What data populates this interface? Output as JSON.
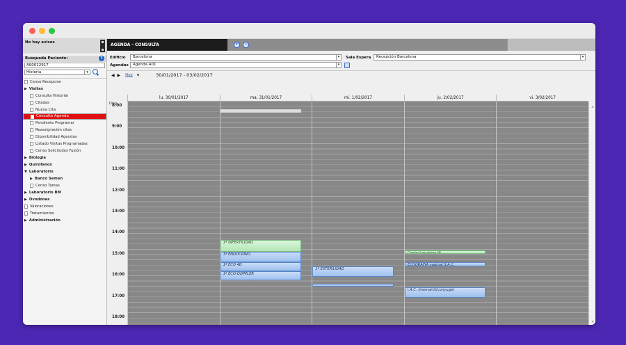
{
  "sidebar": {
    "avisos": "No hay avisos",
    "busqueda_label": "Busqueda Paciente:",
    "patient_id": "A00012917",
    "historia": "Historia",
    "tree": [
      {
        "label": "Censo Recepcion",
        "kind": "doc",
        "indent": 0
      },
      {
        "label": "Visitas",
        "kind": "folder",
        "indent": 0,
        "bold": true
      },
      {
        "label": "Consulta Historial",
        "kind": "doc",
        "indent": 1
      },
      {
        "label": "Citadas",
        "kind": "doc",
        "indent": 1
      },
      {
        "label": "Nueva Cita",
        "kind": "doc",
        "indent": 1
      },
      {
        "label": "Consulta Agenda",
        "kind": "doc",
        "indent": 1,
        "selected": true
      },
      {
        "label": "Pendiente Programar",
        "kind": "doc",
        "indent": 1
      },
      {
        "label": "Reassignación citas",
        "kind": "doc",
        "indent": 1
      },
      {
        "label": "Diponibilidad Agendas",
        "kind": "doc",
        "indent": 1
      },
      {
        "label": "Listado Visitas Programadas",
        "kind": "doc",
        "indent": 1
      },
      {
        "label": "Censo Solicitudes Fusión",
        "kind": "doc",
        "indent": 1
      },
      {
        "label": "Biologia",
        "kind": "folder",
        "indent": 0,
        "bold": true
      },
      {
        "label": "Quirofanos",
        "kind": "folder",
        "indent": 0,
        "bold": true
      },
      {
        "label": "Laboratorio",
        "kind": "open",
        "indent": 0,
        "bold": true
      },
      {
        "label": "Banco Semen",
        "kind": "folder",
        "indent": 1,
        "bold": true
      },
      {
        "label": "Censo Tareas",
        "kind": "doc",
        "indent": 1
      },
      {
        "label": "Laboratorio BM",
        "kind": "folder",
        "indent": 0,
        "bold": true
      },
      {
        "label": "Ovodonas",
        "kind": "folder",
        "indent": 0,
        "bold": true
      },
      {
        "label": "Valoraciones",
        "kind": "doc",
        "indent": 0
      },
      {
        "label": "Tratamientos",
        "kind": "doc",
        "indent": 0
      },
      {
        "label": "Administración",
        "kind": "folder",
        "indent": 0,
        "bold": true
      }
    ]
  },
  "header": {
    "title": "AGENDA - CONSULTA"
  },
  "form": {
    "edificio_label": "Edificio",
    "edificio_value": "Barcelona",
    "agendas_label": "Agendas",
    "agendas_value": "Agenda A01",
    "sala_label": "Sala Espera",
    "sala_value": "Recepción Barcelona"
  },
  "nav": {
    "arrows": "◀ ▶",
    "hoy": "Hoy",
    "range": "30/01/2017 - 03/02/2017"
  },
  "calendar": {
    "disp_label": "Disp.",
    "days": [
      "lu. 30/01/2017",
      "ma. 31/01/2017",
      "mi. 1/02/2017",
      "ju. 2/02/2017",
      "vi. 3/02/2017"
    ],
    "hours": [
      "8:00",
      "9:00",
      "10:00",
      "11:00",
      "12:00",
      "13:00",
      "14:00",
      "15:00",
      "16:00",
      "17:00",
      "18:00"
    ],
    "events": [
      {
        "day": 1,
        "start": "8:10",
        "end": "8:20",
        "label": "",
        "style": "white"
      },
      {
        "day": 1,
        "start": "14:20",
        "end": "14:55",
        "label": "1ª INFERTILIDAD",
        "style": "green"
      },
      {
        "day": 1,
        "start": "14:55",
        "end": "15:25",
        "label": "1ª ENDOCRINO.",
        "style": "blue"
      },
      {
        "day": 1,
        "start": "15:25",
        "end": "15:50",
        "label": "1ª ECO 4D",
        "style": "blue"
      },
      {
        "day": 1,
        "start": "15:50",
        "end": "16:15",
        "label": "1ª ECO-DOPPLER",
        "style": "blue"
      },
      {
        "day": 2,
        "start": "15:35",
        "end": "16:05",
        "label": "1ª ESTERILIDAD",
        "style": "blue"
      },
      {
        "day": 2,
        "start": "16:25",
        "end": "16:32",
        "label": "",
        "style": "blue"
      },
      {
        "day": 3,
        "start": "14:50",
        "end": "15:00",
        "label": "Control mujeres IA",
        "style": "green"
      },
      {
        "day": 3,
        "start": "15:25",
        "end": "15:35",
        "label": "ECOGRAFIA vaginal S.A.C.",
        "style": "blue"
      },
      {
        "day": 3,
        "start": "16:35",
        "end": "17:05",
        "label": "I.A.C. (inemarti)(conyuge)",
        "style": "blue"
      }
    ]
  }
}
